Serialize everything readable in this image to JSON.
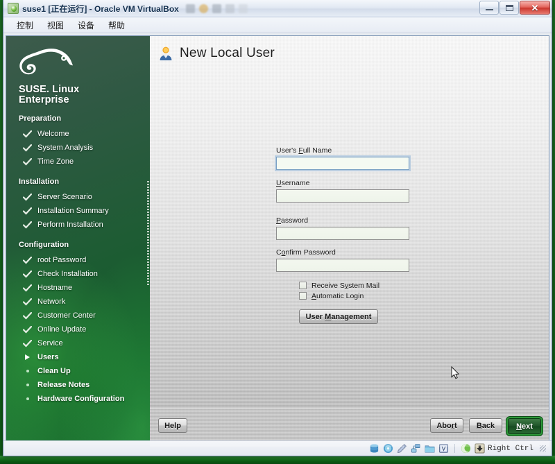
{
  "window": {
    "title": "suse1 [正在运行] - Oracle VM VirtualBox",
    "icon": "virtualbox-vm-icon",
    "controls": {
      "minimize": "minimize-icon",
      "maximize": "maximize-icon",
      "close": "✕"
    }
  },
  "menubar": {
    "items": [
      {
        "label": "控制"
      },
      {
        "label": "视图"
      },
      {
        "label": "设备"
      },
      {
        "label": "帮助"
      }
    ]
  },
  "sidebar": {
    "brand_line1": "SUSE. Linux",
    "brand_line2": "Enterprise",
    "logo": "suse-chameleon-logo",
    "sections": [
      {
        "title": "Preparation",
        "items": [
          {
            "label": "Welcome",
            "state": "done"
          },
          {
            "label": "System Analysis",
            "state": "done"
          },
          {
            "label": "Time Zone",
            "state": "done"
          }
        ]
      },
      {
        "title": "Installation",
        "items": [
          {
            "label": "Server Scenario",
            "state": "done"
          },
          {
            "label": "Installation Summary",
            "state": "done"
          },
          {
            "label": "Perform Installation",
            "state": "done"
          }
        ]
      },
      {
        "title": "Configuration",
        "items": [
          {
            "label": "root Password",
            "state": "done"
          },
          {
            "label": "Check Installation",
            "state": "done"
          },
          {
            "label": "Hostname",
            "state": "done"
          },
          {
            "label": "Network",
            "state": "done"
          },
          {
            "label": "Customer Center",
            "state": "done"
          },
          {
            "label": "Online Update",
            "state": "done"
          },
          {
            "label": "Service",
            "state": "done"
          },
          {
            "label": "Users",
            "state": "current"
          },
          {
            "label": "Clean Up",
            "state": "todo"
          },
          {
            "label": "Release Notes",
            "state": "todo"
          },
          {
            "label": "Hardware Configuration",
            "state": "todo"
          }
        ]
      }
    ]
  },
  "page": {
    "title": "New Local User",
    "icon": "user-icon"
  },
  "form": {
    "fields": [
      {
        "label_pre": "User's ",
        "label_mn": "F",
        "label_post": "ull Name",
        "value": "",
        "focused": true
      },
      {
        "label_pre": "",
        "label_mn": "U",
        "label_post": "sername",
        "value": "",
        "focused": false
      },
      {
        "label_pre": "",
        "label_mn": "P",
        "label_post": "assword",
        "value": "",
        "focused": false
      },
      {
        "label_pre": "C",
        "label_mn": "o",
        "label_post": "nfirm Password",
        "value": "",
        "focused": false
      }
    ],
    "checkboxes": [
      {
        "label_pre": "Receive S",
        "label_mn": "y",
        "label_post": "stem Mail",
        "checked": false
      },
      {
        "label_pre": "",
        "label_mn": "A",
        "label_post": "utomatic Login",
        "checked": false
      }
    ],
    "user_management": {
      "pre": "User ",
      "mn": "M",
      "post": "anagement"
    }
  },
  "buttons": {
    "help": {
      "pre": "Help",
      "mn": "",
      "post": ""
    },
    "abort": {
      "pre": "Abo",
      "mn": "r",
      "post": "t"
    },
    "back": {
      "pre": "",
      "mn": "B",
      "post": "ack"
    },
    "next": {
      "pre": "",
      "mn": "N",
      "post": "ext"
    }
  },
  "statusbar": {
    "icons": [
      "hard-disk-icon",
      "optical-disk-icon",
      "floppy-disk-icon",
      "network-adapter-icon",
      "shared-folder-icon",
      "vm-display-icon",
      "usb-icon"
    ],
    "hostkey_icon": "host-key-icon",
    "hostkey_label": "Right Ctrl"
  },
  "colors": {
    "suse_green": "#0f5a25",
    "accent_green": "#2f9a3a",
    "title_blue": "#13304f",
    "close_red": "#c9352c"
  }
}
